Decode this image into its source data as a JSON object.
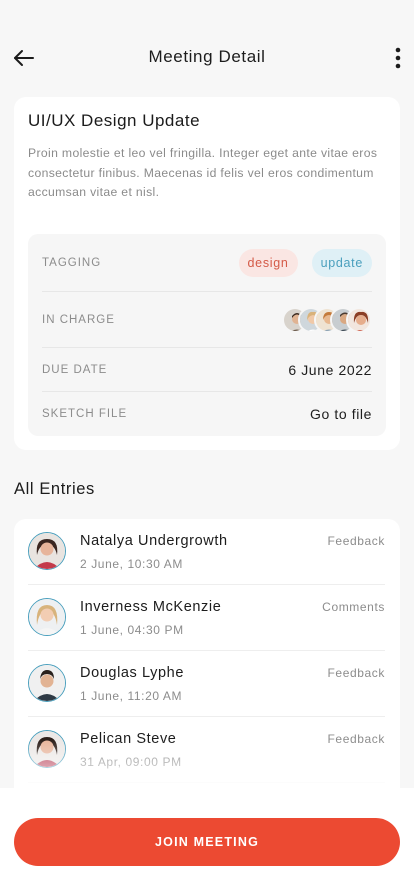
{
  "header": {
    "title": "Meeting Detail",
    "back_icon": "arrow-left-icon",
    "more_icon": "more-vertical-icon"
  },
  "meeting": {
    "title": "UI/UX Design Update",
    "description": "Proin molestie et leo vel fringilla. Integer eget ante vitae eros consectetur finibus. Maecenas id felis vel eros condimentum accumsan vitae et nisl.",
    "tagging": {
      "label": "TAGGING",
      "tags": [
        {
          "label": "design",
          "color": "#d45a47",
          "bg": "#fae6e3"
        },
        {
          "label": "update",
          "color": "#4a9fbd",
          "bg": "#dff0f6"
        }
      ]
    },
    "in_charge": {
      "label": "IN CHARGE",
      "avatar_count": 5
    },
    "due_date": {
      "label": "DUE DATE",
      "value": "6 June 2022"
    },
    "sketch_file": {
      "label": "SKETCH FILE",
      "value": "Go to file"
    }
  },
  "entries": {
    "title": "All Entries",
    "items": [
      {
        "name": "Natalya Undergrowth",
        "time": "2 June, 10:30 AM",
        "type": "Feedback"
      },
      {
        "name": "Inverness McKenzie",
        "time": "1 June, 04:30 PM",
        "type": "Comments"
      },
      {
        "name": "Douglas Lyphe",
        "time": "1 June, 11:20 AM",
        "type": "Feedback"
      },
      {
        "name": "Pelican Steve",
        "time": "31 Apr, 09:00 PM",
        "type": "Feedback"
      }
    ]
  },
  "join_button": {
    "label": "JOIN MEETING"
  },
  "colors": {
    "accent": "#ec4a32",
    "background": "#f7f7f7",
    "avatar_ring": "#4a9fbd"
  }
}
